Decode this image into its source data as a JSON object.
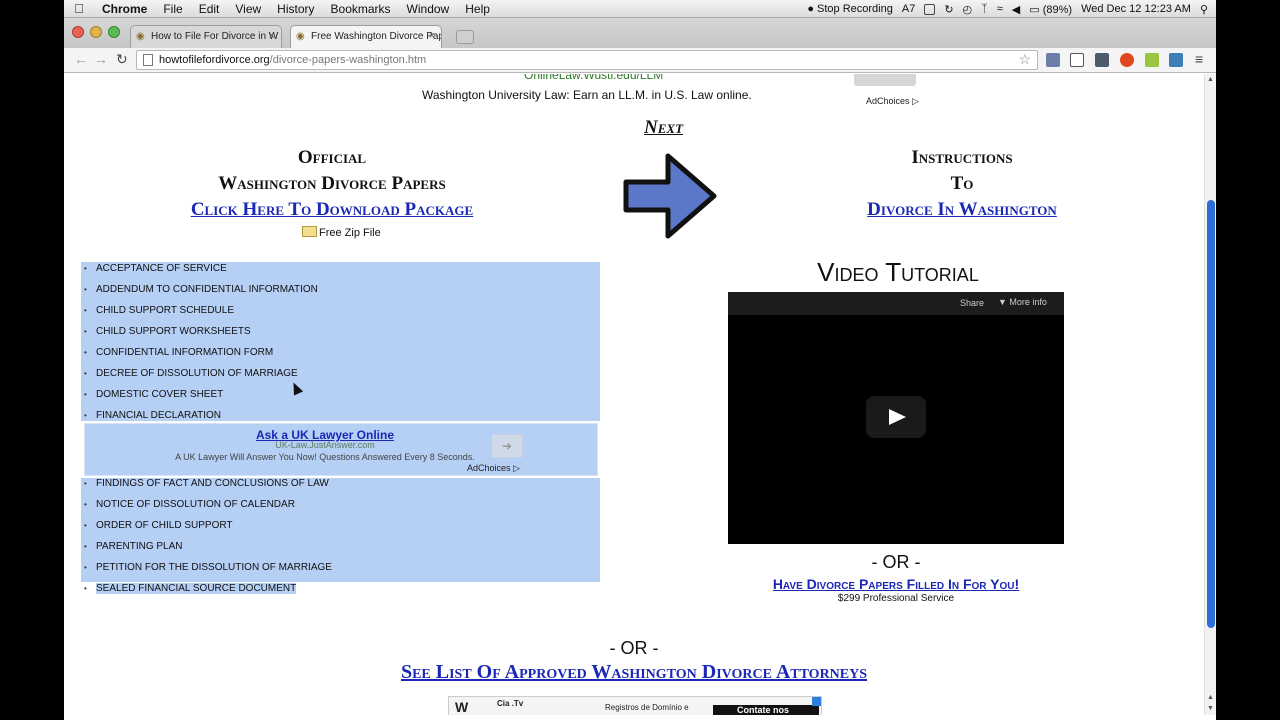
{
  "menubar": {
    "apple": "",
    "app": "Chrome",
    "items": [
      "File",
      "Edit",
      "View",
      "History",
      "Bookmarks",
      "Window",
      "Help"
    ],
    "stop_recording": "Stop Recording",
    "adobe_count": "7",
    "battery": "(89%)",
    "datetime": "Wed Dec 12  12:23 AM"
  },
  "tabs": [
    {
      "title": "How to File For Divorce in W",
      "active": false
    },
    {
      "title": "Free Washington Divorce Pap",
      "active": true
    }
  ],
  "address": {
    "host": "howtofilefordivorce.org",
    "path": "/divorce-papers-washington.htm"
  },
  "page": {
    "ad_top": {
      "url": "OnlineLaw.Wustl.edu/LLM",
      "text": "Washington University Law: Earn an LL.M. in U.S. Law online.",
      "adchoices": "AdChoices"
    },
    "next": "Next",
    "official": {
      "line1": "Official",
      "line2": "Washington Divorce Papers",
      "link": "Click Here To Download Package",
      "zip": "Free Zip File"
    },
    "instructions": {
      "line1": "Instructions",
      "line2": "To",
      "link": "Divorce In Washington"
    },
    "forms_a": [
      "Acceptance of Service",
      "Addendum to Confidential Information",
      "Child Support Schedule",
      "Child Support Worksheets",
      "Confidential Information Form",
      "Decree of Dissolution of Marriage",
      "Domestic Cover Sheet",
      "Financial Declaration"
    ],
    "ad_mid": {
      "title": "Ask a UK Lawyer Online",
      "url": "UK-Law.JustAnswer.com",
      "desc": "A UK Lawyer Will Answer You Now! Questions Answered Every 8 Seconds.",
      "adchoices": "AdChoices"
    },
    "forms_b": [
      "Findings of Fact and Conclusions of Law",
      "Notice of Dissolution of Calendar",
      "Order of Child Support",
      "Parenting Plan",
      "Petition for the Dissolution of Marriage",
      "Sealed Financial Source Document"
    ],
    "video": {
      "title": "Video Tutorial",
      "share": "Share",
      "more_info": "More info"
    },
    "or": "- OR -",
    "filled_link": "Have Divorce Papers Filled In For You!",
    "price": "$299 Professional Service",
    "attorneys_link": "See List Of Approved Washington Divorce Attorneys",
    "ad_bottom": {
      "logo": "W",
      "name": "Cia .Tv",
      "text": "Registros de Domínio e",
      "cta": "Contate nos"
    }
  },
  "colors": {
    "link": "#1a28b5",
    "highlight": "#b6cff5",
    "arrow": "#5b78c8"
  }
}
